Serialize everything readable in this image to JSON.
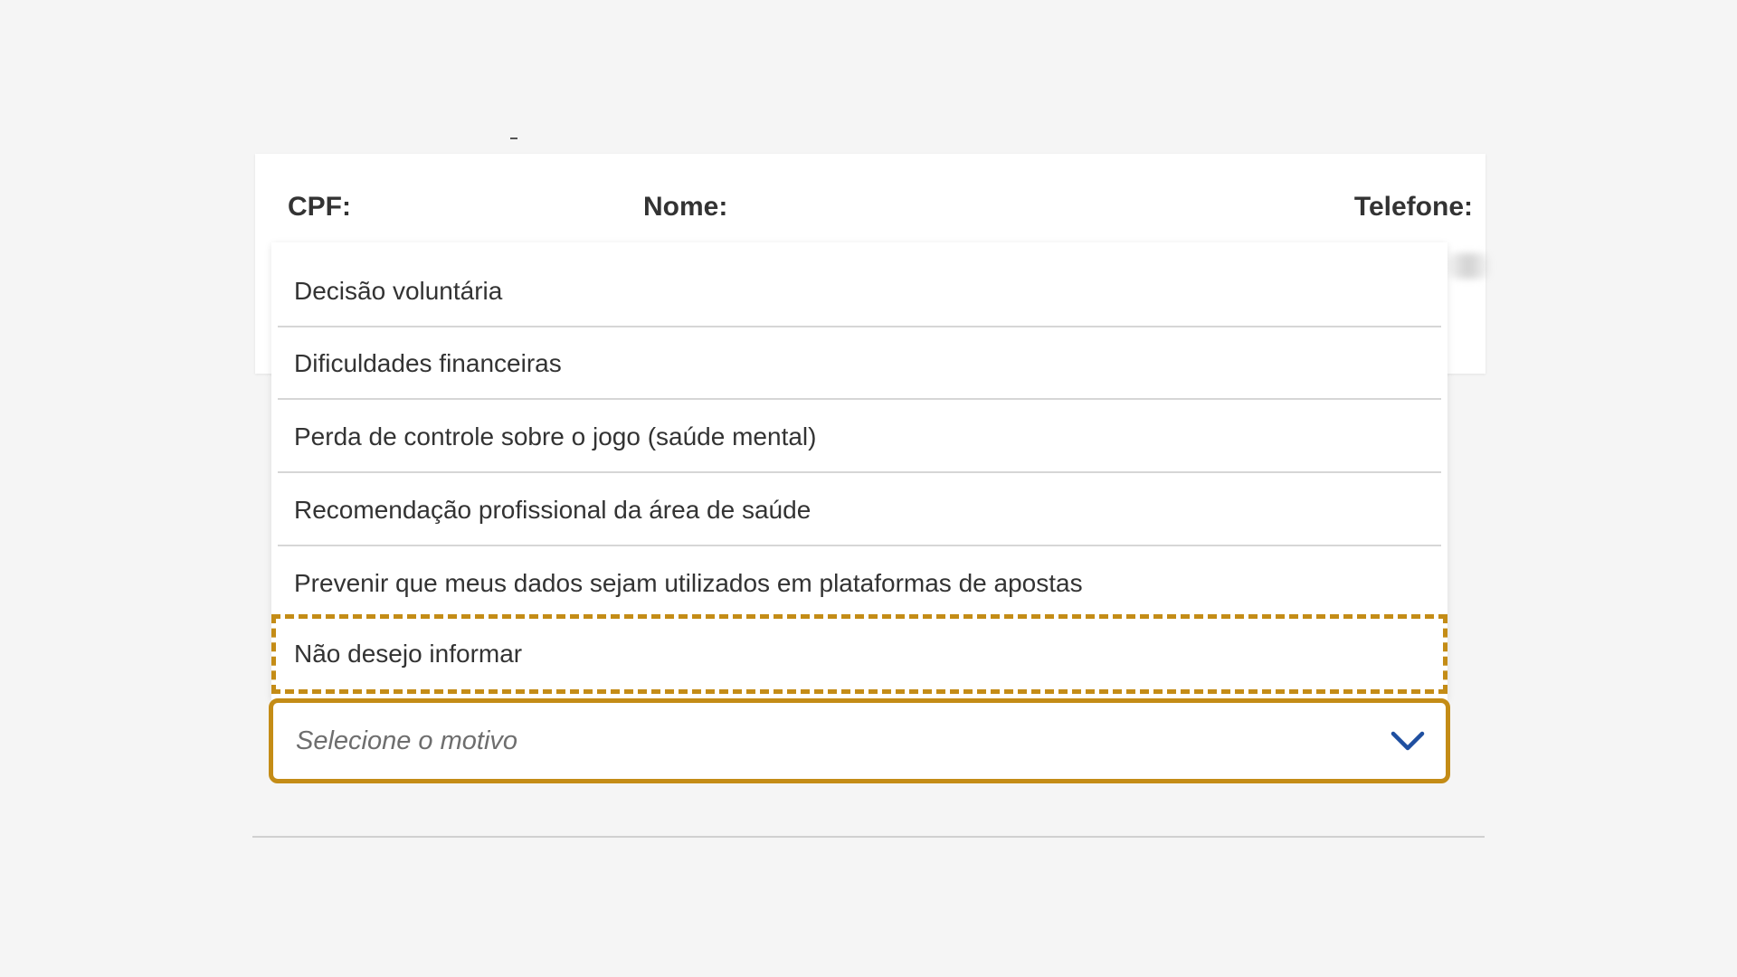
{
  "info_card": {
    "cpf_label": "CPF:",
    "nome_label": "Nome:",
    "telefone_label": "Telefone:"
  },
  "dropdown": {
    "options": [
      "Decisão voluntária",
      "Dificuldades financeiras",
      "Perda de controle sobre o jogo (saúde mental)",
      "Recomendação profissional da área de saúde",
      "Prevenir que meus dados sejam utilizados em plataformas de apostas",
      "Não desejo informar"
    ],
    "highlighted_option": "Não desejo informar"
  },
  "select": {
    "placeholder": "Selecione o motivo",
    "icon": "chevron-down-icon"
  },
  "colors": {
    "accent_border": "#c48c16",
    "chevron": "#1f4fa0"
  }
}
